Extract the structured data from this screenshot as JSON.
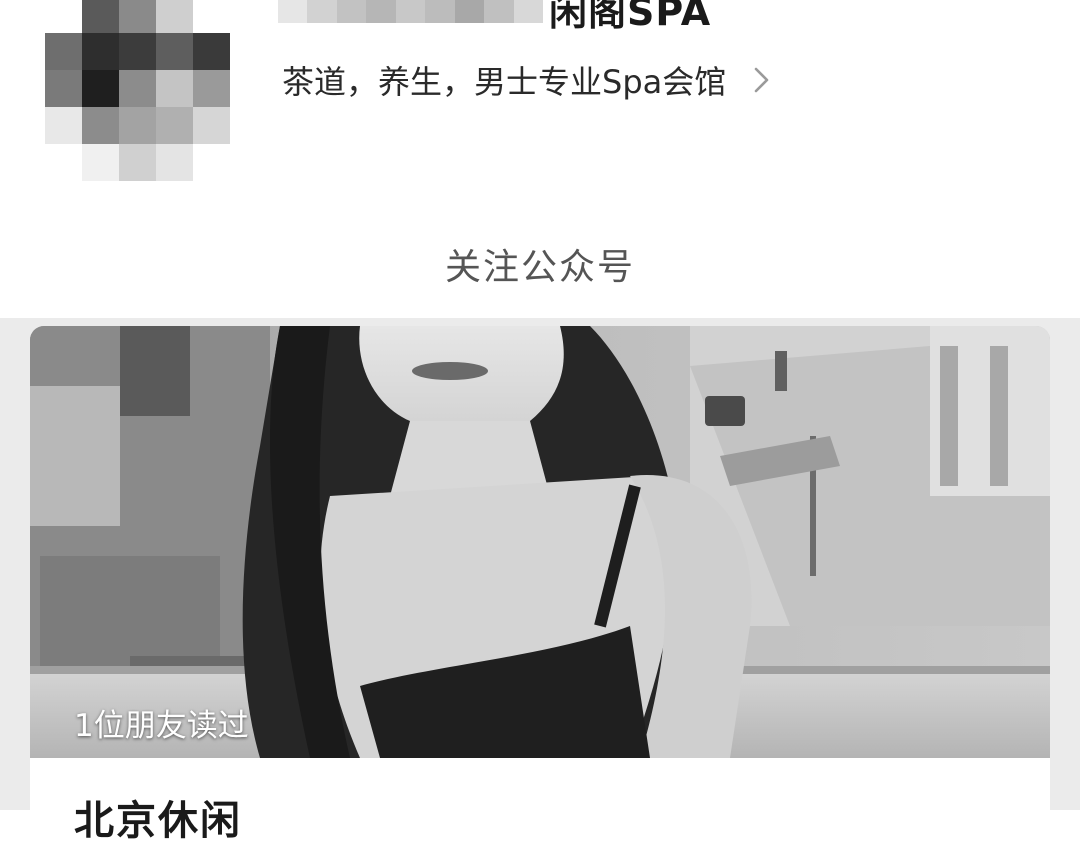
{
  "account": {
    "name_suffix": "闲阁SPA",
    "intro": "茶道，养生，男士专业Spa会馆",
    "follow_label": "关注公众号",
    "avatar_description": "pixelated avatar"
  },
  "icons": {
    "intro_chevron": "chevron-right-icon"
  },
  "article": {
    "read_badge": "1位朋友读过",
    "title": "北京休闲",
    "image_description": "black-and-white photo of a woman with long hair on a balcony above a shopping street"
  },
  "colors": {
    "header_bg": "#ffffff",
    "feed_bg": "#ebebeb",
    "follow_text": "#555555"
  }
}
